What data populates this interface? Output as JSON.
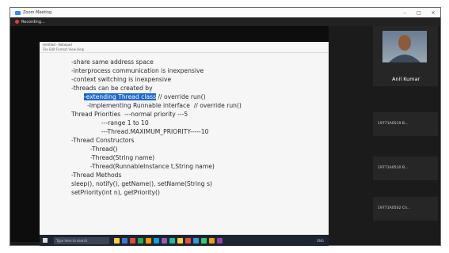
{
  "window": {
    "title": "Zoom Meeting",
    "controls": [
      "–",
      "□",
      "×"
    ],
    "recording_label": "Recording..."
  },
  "editor": {
    "title": "Untitled - Notepad",
    "menu": "File  Edit  Format  View  Help",
    "lines": [
      "-share same address space",
      "-interprocess communication is inexpensive",
      "-context switching is inexpensive",
      "-threads can be created by",
      "-Implementing Runnable interface  // override run()",
      "Thread Priorities  ---normal priority ---5",
      "---range 1 to 10",
      "---Thread.MAXIMUM_PRIORITY-----10",
      "-Thread Constructors",
      "-Thread()",
      "-Thread(String name)",
      "-Thread(RunnableInstance t,String name)",
      "-Thread Methods",
      "sleep(), notify(), getName(), setName(String s)",
      "setPriority(int n), getPriority()"
    ],
    "highlighted_text": "-extending Thread class",
    "highlighted_suffix": " // override run()"
  },
  "taskbar": {
    "search_placeholder": "Type here to search",
    "icon_colors": [
      "#ffcf3a",
      "#3a7bd5",
      "#e24a3b",
      "#2aa84a",
      "#ff9900",
      "#0aa4e0",
      "#9b59b6",
      "#1abc9c",
      "#ffcf3a",
      "#e74c3c",
      "#3498db",
      "#2ecc71",
      "#f39c12",
      "#8e44ad"
    ],
    "tray_text": "ENG"
  },
  "participants": [
    {
      "name": "Anil Kumar",
      "has_video": true
    },
    {
      "name": "19771A0519 B..."
    },
    {
      "name": "19771A0510 B..."
    },
    {
      "name": "19771A0502 Ch..."
    }
  ]
}
